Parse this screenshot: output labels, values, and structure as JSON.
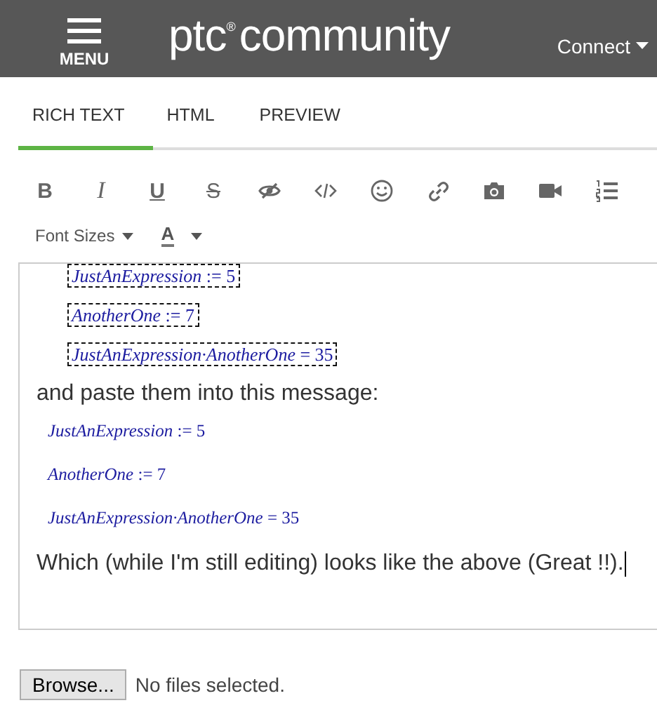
{
  "header": {
    "menu_label": "MENU",
    "logo": {
      "brand": "ptc",
      "mark": "®",
      "name": "community"
    },
    "nav": "Connect"
  },
  "tabs": [
    {
      "label": "RICH TEXT",
      "selected": true
    },
    {
      "label": "HTML",
      "selected": false
    },
    {
      "label": "PREVIEW",
      "selected": false
    }
  ],
  "toolbar": [
    {
      "kind": "bold",
      "label": "B"
    },
    {
      "kind": "italic",
      "label": "I"
    },
    {
      "kind": "underline",
      "label": "U"
    },
    {
      "kind": "strike",
      "label": "S"
    },
    {
      "kind": "spoiler"
    },
    {
      "kind": "code"
    },
    {
      "kind": "emoji"
    },
    {
      "kind": "link"
    },
    {
      "kind": "photo"
    },
    {
      "kind": "video"
    },
    {
      "kind": "numbered-list"
    }
  ],
  "format_bar": {
    "font_sizes": "Font Sizes",
    "text_color": "A"
  },
  "editor": [
    {
      "kind": "region",
      "text": "*JustAnExpression* := 5"
    },
    {
      "kind": "region",
      "text": "*AnotherOne* := 7"
    },
    {
      "kind": "region",
      "text": "*JustAnExpression·AnotherOne* = 35"
    },
    {
      "kind": "text",
      "text": "and paste them into this message:"
    },
    {
      "kind": "math",
      "text": "*JustAnExpression* := 5"
    },
    {
      "kind": "math",
      "text": "*AnotherOne* := 7"
    },
    {
      "kind": "math",
      "text": "*JustAnExpression·AnotherOne* = 35"
    },
    {
      "kind": "text",
      "text": "Which (while I'm still editing) looks like the above (Great !!).",
      "caret": true
    }
  ],
  "attachment": {
    "button": "Browse...",
    "status": "No files selected."
  }
}
